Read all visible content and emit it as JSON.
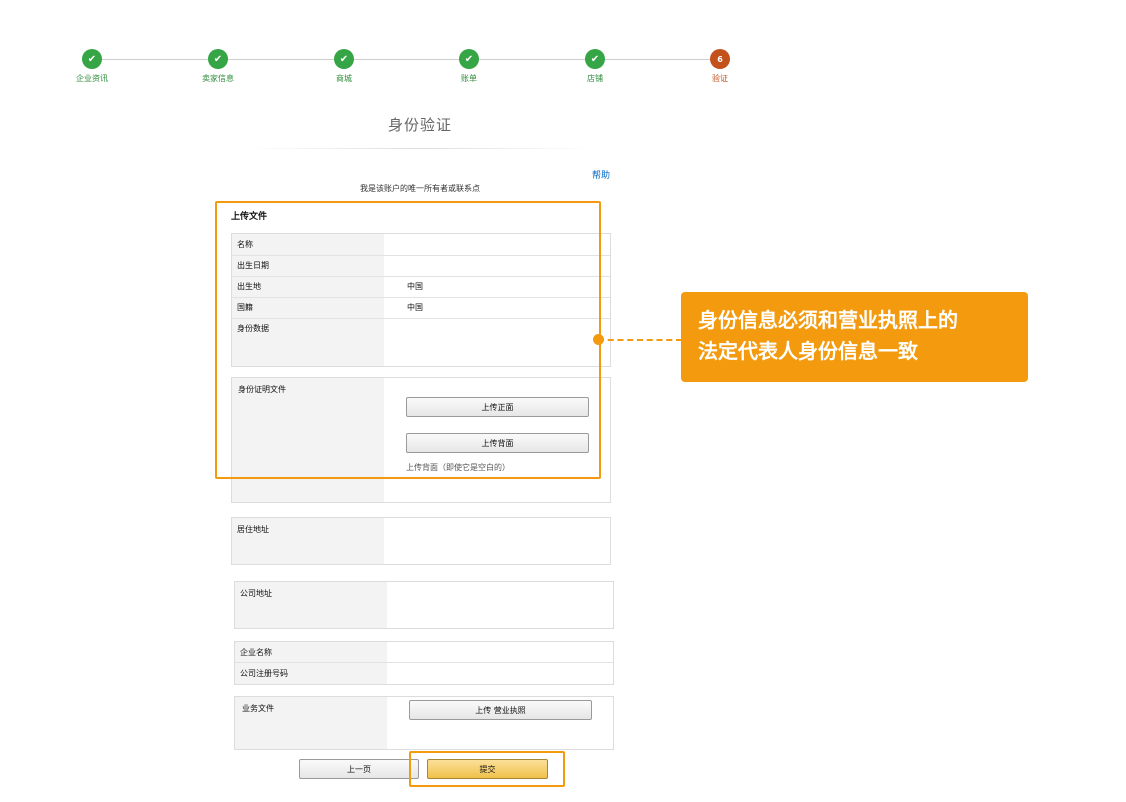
{
  "steps": [
    {
      "label": "企业资讯",
      "state": "done"
    },
    {
      "label": "卖家信息",
      "state": "done"
    },
    {
      "label": "商城",
      "state": "done"
    },
    {
      "label": "账单",
      "state": "done"
    },
    {
      "label": "店铺",
      "state": "done"
    },
    {
      "label": "验证",
      "state": "current",
      "number": "6"
    }
  ],
  "page_title": "身份验证",
  "help_link": "帮助",
  "owner_note": "我是该账户的唯一所有者或联系点",
  "upload_section": {
    "title": "上传文件",
    "fields": [
      {
        "label": "名称",
        "value": ""
      },
      {
        "label": "出生日期",
        "value": ""
      },
      {
        "label": "出生地",
        "value": "中国"
      },
      {
        "label": "国籍",
        "value": "中国"
      },
      {
        "label": "身份数据",
        "value": ""
      }
    ]
  },
  "id_document": {
    "label": "身份证明文件",
    "upload_front": "上传正面",
    "upload_back": "上传背面",
    "hint": "上传背面（即使它是空白的）"
  },
  "residence_address": {
    "label": "居住地址"
  },
  "company_address": {
    "label": "公司地址"
  },
  "company_info": {
    "name_label": "企业名称",
    "reg_label": "公司注册号码"
  },
  "business_docs": {
    "label": "业务文件",
    "upload_license": "上传 营业执照"
  },
  "nav": {
    "prev": "上一页",
    "submit": "提交"
  },
  "callout": {
    "line1": "身份信息必须和营业执照上的",
    "line2": "法定代表人身份信息一致"
  },
  "colors": {
    "step_done": "#35a546",
    "step_current": "#c2511c",
    "highlight": "#f39a0e",
    "link": "#0066c0"
  }
}
